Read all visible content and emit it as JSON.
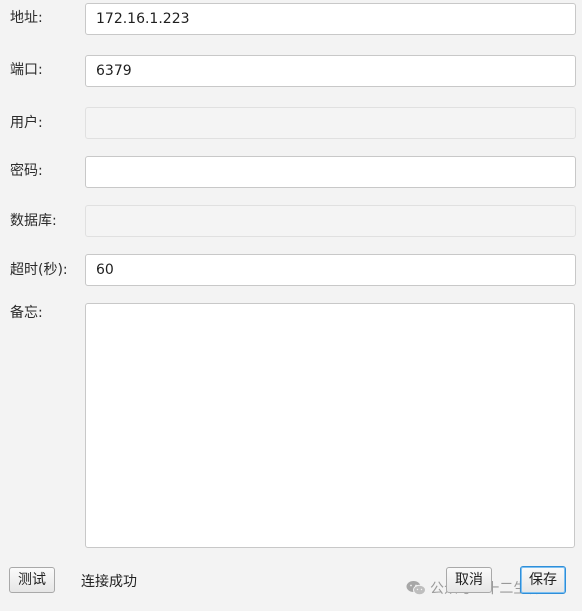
{
  "form": {
    "address": {
      "label": "地址:",
      "value": "172.16.1.223"
    },
    "port": {
      "label": "端口:",
      "value": "6379"
    },
    "user": {
      "label": "用户:",
      "value": ""
    },
    "password": {
      "label": "密码:",
      "value": ""
    },
    "database": {
      "label": "数据库:",
      "value": ""
    },
    "timeout": {
      "label": "超时(秒):",
      "value": "60"
    },
    "remark": {
      "label": "备忘:",
      "value": ""
    }
  },
  "footer": {
    "test_label": "测试",
    "status_text": "连接成功",
    "cancel_label": "取消",
    "save_label": "保存"
  },
  "watermark": {
    "text": "公众号 · 十二生神",
    "icon": "wechat-icon"
  }
}
